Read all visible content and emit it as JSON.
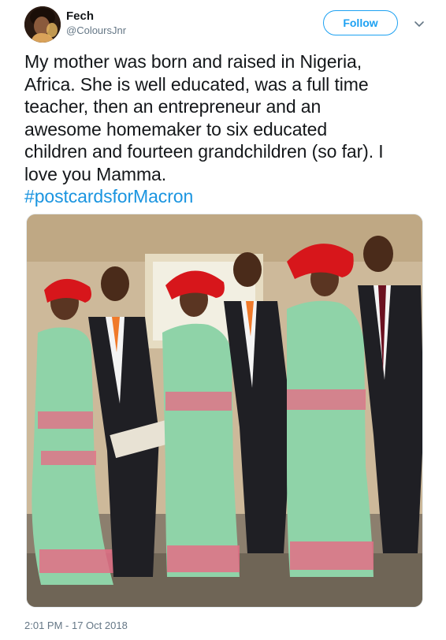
{
  "user": {
    "display_name": "Fech",
    "handle": "@ColoursJnr"
  },
  "actions": {
    "follow_label": "Follow",
    "more_icon": "chevron-down-icon"
  },
  "tweet": {
    "lines": [
      "My mother was born and raised in Nigeria,",
      "Africa. She is well educated, was a full time",
      "teacher, then an entrepreneur and an",
      "awesome homemaker to six educated",
      "children and fourteen grandchildren (so far). I",
      "love you Mamma."
    ],
    "hashtag": "#postcardsforMacron"
  },
  "timestamp": "2:01 PM - 17 Oct 2018",
  "colors": {
    "accent": "#1da1f2",
    "hashtag": "#1b95e0",
    "muted": "#657786"
  }
}
